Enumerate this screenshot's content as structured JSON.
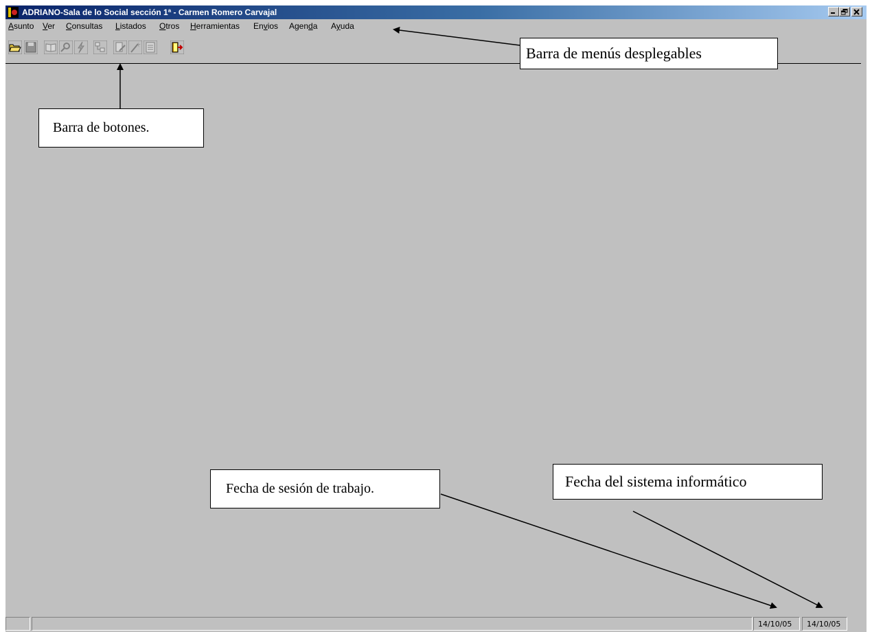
{
  "window": {
    "title": "ADRIANO-Sala de lo Social sección 1ª - Carmen Romero Carvajal",
    "controls": [
      "minimize-icon",
      "restore-icon",
      "close-icon"
    ]
  },
  "menu": {
    "items": [
      {
        "key": "A",
        "rest": "sunto"
      },
      {
        "key": "V",
        "rest": "er"
      },
      {
        "key": "C",
        "rest": "onsultas"
      },
      {
        "key": "L",
        "rest": "istados"
      },
      {
        "key": "O",
        "rest": "tros"
      },
      {
        "key": "H",
        "rest": "erramientas"
      },
      {
        "pre": "En",
        "key": "v",
        "rest": "ios"
      },
      {
        "pre": "Agen",
        "key": "d",
        "rest": "a"
      },
      {
        "pre": "A",
        "key": "y",
        "rest": "uda"
      }
    ]
  },
  "toolbar": {
    "buttons": [
      "open-folder-icon",
      "save-icon",
      "book-icon",
      "search-icon",
      "lightning-icon",
      "tree-icon",
      "edit-icon",
      "wand-icon",
      "print-icon",
      "exit-door-icon"
    ]
  },
  "statusbar": {
    "session_date": "14/10/05",
    "system_date": "14/10/05"
  },
  "annotations": {
    "menu_bar": "Barra de menús desplegables",
    "button_bar": "Barra de botones.",
    "session_date": "Fecha de sesión de trabajo.",
    "system_date": "Fecha del sistema informático"
  }
}
